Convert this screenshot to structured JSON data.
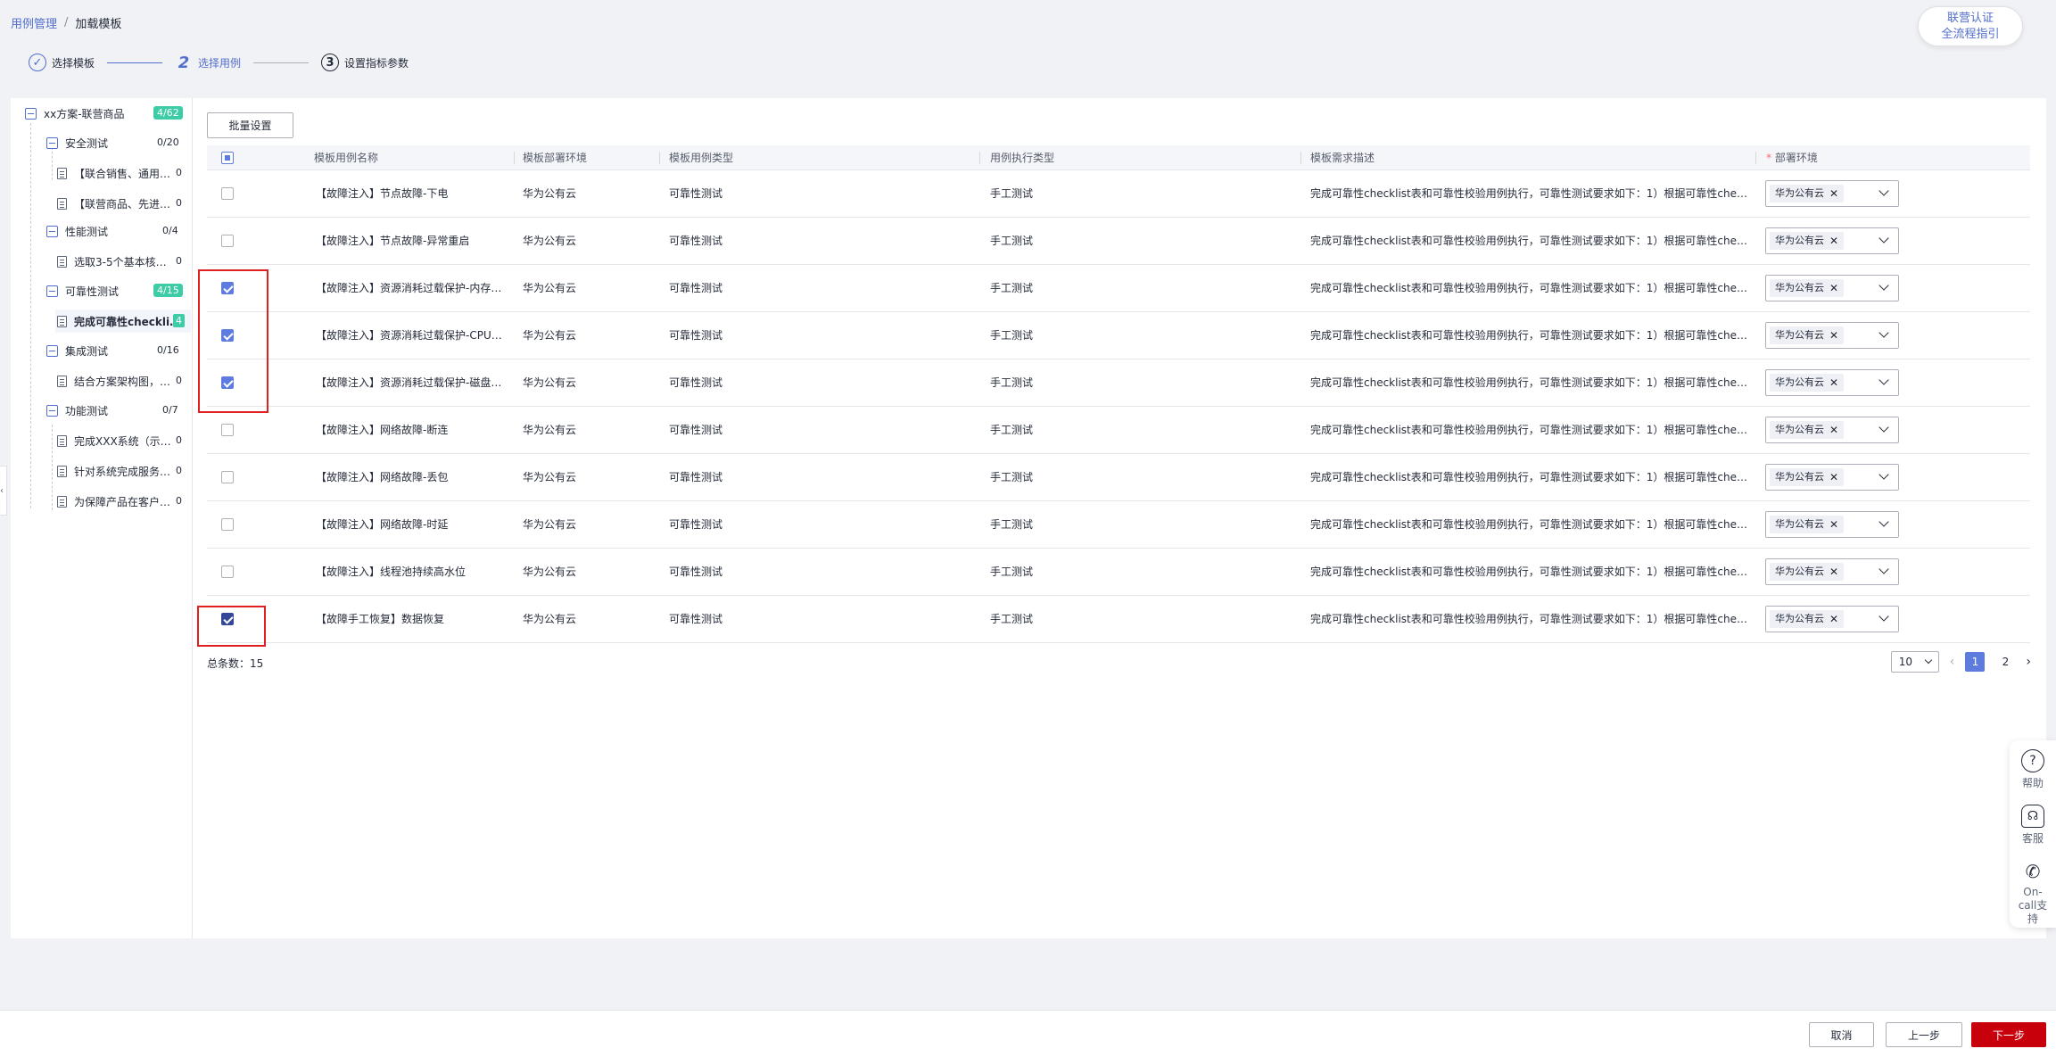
{
  "breadcrumb": {
    "parent": "用例管理",
    "sep": "/",
    "current": "加载模板"
  },
  "help_pill": {
    "line1": "联营认证",
    "line2": "全流程指引"
  },
  "steps": [
    {
      "index": "✓",
      "label": "选择模板"
    },
    {
      "index": "2",
      "label": "选择用例"
    },
    {
      "index": "3",
      "label": "设置指标参数"
    }
  ],
  "tree": {
    "root": {
      "label": "xx方案-联营商品",
      "count": "4/62"
    },
    "groups": [
      {
        "label": "安全测试",
        "count": "0/20",
        "items": [
          {
            "label": "【联合销售、通用…",
            "count": "0"
          },
          {
            "label": "【联营商品、先进…",
            "count": "0"
          }
        ]
      },
      {
        "label": "性能测试",
        "count": "0/4",
        "items": [
          {
            "label": "选取3-5个基本核…",
            "count": "0"
          }
        ]
      },
      {
        "label": "可靠性测试",
        "count": "4/15",
        "items": [
          {
            "label": "完成可靠性checkli…",
            "count": "4"
          }
        ]
      },
      {
        "label": "集成测试",
        "count": "0/16",
        "items": [
          {
            "label": "结合方案架构图，…",
            "count": "0"
          }
        ]
      },
      {
        "label": "功能测试",
        "count": "0/7",
        "items": [
          {
            "label": "完成XXX系统（示…",
            "count": "0"
          },
          {
            "label": "针对系统完成服务…",
            "count": "0"
          },
          {
            "label": "为保障产品在客户…",
            "count": "0"
          }
        ]
      }
    ]
  },
  "batch_label": "批量设置",
  "table": {
    "headers": [
      "模板用例名称",
      "模板部署环境",
      "模板用例类型",
      "用例执行类型",
      "模板需求描述",
      "部署环境"
    ],
    "required_mark": "*",
    "rows": [
      {
        "name": "【故障注入】节点故障-下电",
        "env": "华为公有云",
        "type": "可靠性测试",
        "exec": "手工测试",
        "desc": "完成可靠性checklist表和可靠性校验用例执行，可靠性测试要求如下：1）根据可靠性chec…",
        "deploy": "华为公有云",
        "checked": "no"
      },
      {
        "name": "【故障注入】节点故障-异常重启",
        "env": "华为公有云",
        "type": "可靠性测试",
        "exec": "手工测试",
        "desc": "完成可靠性checklist表和可靠性校验用例执行，可靠性测试要求如下：1）根据可靠性chec…",
        "deploy": "华为公有云",
        "checked": "no"
      },
      {
        "name": "【故障注入】资源消耗过载保护-内存…",
        "env": "华为公有云",
        "type": "可靠性测试",
        "exec": "手工测试",
        "desc": "完成可靠性checklist表和可靠性校验用例执行，可靠性测试要求如下：1）根据可靠性chec…",
        "deploy": "华为公有云",
        "checked": "yes"
      },
      {
        "name": "【故障注入】资源消耗过载保护-CPU…",
        "env": "华为公有云",
        "type": "可靠性测试",
        "exec": "手工测试",
        "desc": "完成可靠性checklist表和可靠性校验用例执行，可靠性测试要求如下：1）根据可靠性chec…",
        "deploy": "华为公有云",
        "checked": "yes"
      },
      {
        "name": "【故障注入】资源消耗过载保护-磁盘…",
        "env": "华为公有云",
        "type": "可靠性测试",
        "exec": "手工测试",
        "desc": "完成可靠性checklist表和可靠性校验用例执行，可靠性测试要求如下：1）根据可靠性chec…",
        "deploy": "华为公有云",
        "checked": "yes"
      },
      {
        "name": "【故障注入】网络故障-断连",
        "env": "华为公有云",
        "type": "可靠性测试",
        "exec": "手工测试",
        "desc": "完成可靠性checklist表和可靠性校验用例执行，可靠性测试要求如下：1）根据可靠性chec…",
        "deploy": "华为公有云",
        "checked": "no"
      },
      {
        "name": "【故障注入】网络故障-丢包",
        "env": "华为公有云",
        "type": "可靠性测试",
        "exec": "手工测试",
        "desc": "完成可靠性checklist表和可靠性校验用例执行，可靠性测试要求如下：1）根据可靠性chec…",
        "deploy": "华为公有云",
        "checked": "no"
      },
      {
        "name": "【故障注入】网络故障-时延",
        "env": "华为公有云",
        "type": "可靠性测试",
        "exec": "手工测试",
        "desc": "完成可靠性checklist表和可靠性校验用例执行，可靠性测试要求如下：1）根据可靠性chec…",
        "deploy": "华为公有云",
        "checked": "no"
      },
      {
        "name": "【故障注入】线程池持续高水位",
        "env": "华为公有云",
        "type": "可靠性测试",
        "exec": "手工测试",
        "desc": "完成可靠性checklist表和可靠性校验用例执行，可靠性测试要求如下：1）根据可靠性chec…",
        "deploy": "华为公有云",
        "checked": "no"
      },
      {
        "name": "【故障手工恢复】数据恢复",
        "env": "华为公有云",
        "type": "可靠性测试",
        "exec": "手工测试",
        "desc": "完成可靠性checklist表和可靠性校验用例执行，可靠性测试要求如下：1）根据可靠性chec…",
        "deploy": "华为公有云",
        "checked": "yes-dark"
      }
    ]
  },
  "pagination": {
    "total_label": "总条数：15",
    "page_size": "10",
    "pages": [
      "1",
      "2"
    ],
    "current": "1"
  },
  "float_panel": [
    {
      "icon": "help-icon",
      "glyph": "?",
      "label": "帮助"
    },
    {
      "icon": "headset-icon",
      "glyph": "☊",
      "label": "客服"
    },
    {
      "icon": "phone-icon",
      "glyph": "✆",
      "label": "On-call支持"
    }
  ],
  "footer": {
    "cancel": "取消",
    "prev": "上一步",
    "next": "下一步"
  },
  "colors": {
    "accent": "#5e7ce0",
    "brand_red": "#c7000b",
    "success": "#3dcca6",
    "highlight": "#e02020"
  }
}
